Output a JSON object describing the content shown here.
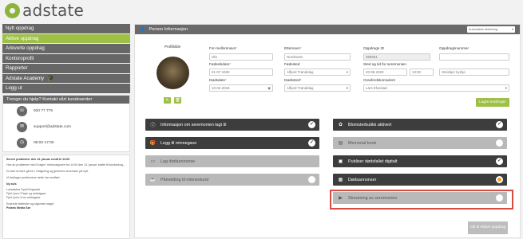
{
  "brand": {
    "name": "adstate"
  },
  "sidebar": {
    "items": [
      {
        "label": "Nytt oppdrag"
      },
      {
        "label": "Aktive oppdrag"
      },
      {
        "label": "Arkiverte oppdrag"
      },
      {
        "label": "Kontoroprofil"
      },
      {
        "label": "Rapporter"
      },
      {
        "label": "Adstate Academy"
      },
      {
        "label": "Logg ut"
      }
    ],
    "help": {
      "title": "Trenger du hjelp? Kontakt vårt kundesenter",
      "phone": "920 77 776",
      "email": "support@adstate.com",
      "hours": "08:00-17:00"
    },
    "news": [
      "Server problemer den 14. januar rundt kl 14:00",
      "Hos du problemer med å lagre i informasjonen fra 14:00 den 14. januar, støtte til kundeskog... ",
      "Du kan ta bare gå inn i redigering og generere annonsen på nytt.",
      "Vi beklager problemene dette har medført.",
      "Ny avis",
      "Lokalavisa Trysil-Engerdal",
      "Fjell-Ljom i Papir og nettutgave",
      "Fjell-Ljom i Kun nettutgave",
      "Endrede tidsfrister og utgivelse dager",
      "Polaris Media Sør"
    ]
  },
  "main": {
    "header": "Person Informasjon",
    "header_select": "Automatisk aktivering",
    "photo_label": "Profilbilde",
    "fields": {
      "firstname": {
        "label": "For-mellomnavn",
        "value": "Ola"
      },
      "lastname": {
        "label": "Etternavn",
        "value": "Nordmann"
      },
      "order_id": {
        "label": "Oppdrags ID",
        "value": "365561"
      },
      "order_no": {
        "label": "Oppdragsnummer",
        "value": ""
      },
      "birthdate": {
        "label": "Fødselsdato",
        "value": "01-07-1930"
      },
      "birthplace": {
        "label": "Fødested",
        "value": "Alfjord Trøndelag"
      },
      "ceremony": {
        "label": "Sted og tid for seremonien",
        "date": "20-08-2020",
        "time": "13:00",
        "place": "Steinkjer kyrkje"
      },
      "deathdate": {
        "label": "Dødsdato",
        "value": "10-02-2019"
      },
      "deathplace": {
        "label": "Dødssted",
        "value": "Alfjord Trøndelag"
      },
      "undertaker": {
        "label": "Gravferdskonsulent",
        "value": "Lars Elvestad"
      }
    },
    "save_label": "Lagre endringer",
    "tiles_left": [
      {
        "label": "Informasjon om seremonien lagt til",
        "style": "dark",
        "state": "check",
        "icon": "info-icon"
      },
      {
        "label": "Legg til minnegave",
        "style": "dark",
        "state": "check",
        "icon": "gift-icon"
      },
      {
        "label": "Lag dødsannonse",
        "style": "gray",
        "state": "none",
        "icon": "document-icon"
      },
      {
        "label": "Påmelding til minnestund",
        "style": "gray",
        "state": "off",
        "icon": "coffee-icon"
      }
    ],
    "tiles_right": [
      {
        "label": "Blomsterbutikk aktivert",
        "style": "dark",
        "state": "check",
        "icon": "flower-icon"
      },
      {
        "label": "Memorial book",
        "style": "gray",
        "state": "off",
        "icon": "book-icon"
      },
      {
        "label": "Publiser dødsfallet digitalt",
        "style": "dark",
        "state": "check",
        "icon": "monitor-icon"
      },
      {
        "label": "Dødsannonser",
        "style": "dark",
        "state": "orange",
        "icon": "newspaper-icon"
      },
      {
        "label": "Streaming av seremonien",
        "style": "gray",
        "state": "off",
        "icon": "video-icon"
      }
    ],
    "final_button": "Gå til Aktive oppdrag"
  }
}
